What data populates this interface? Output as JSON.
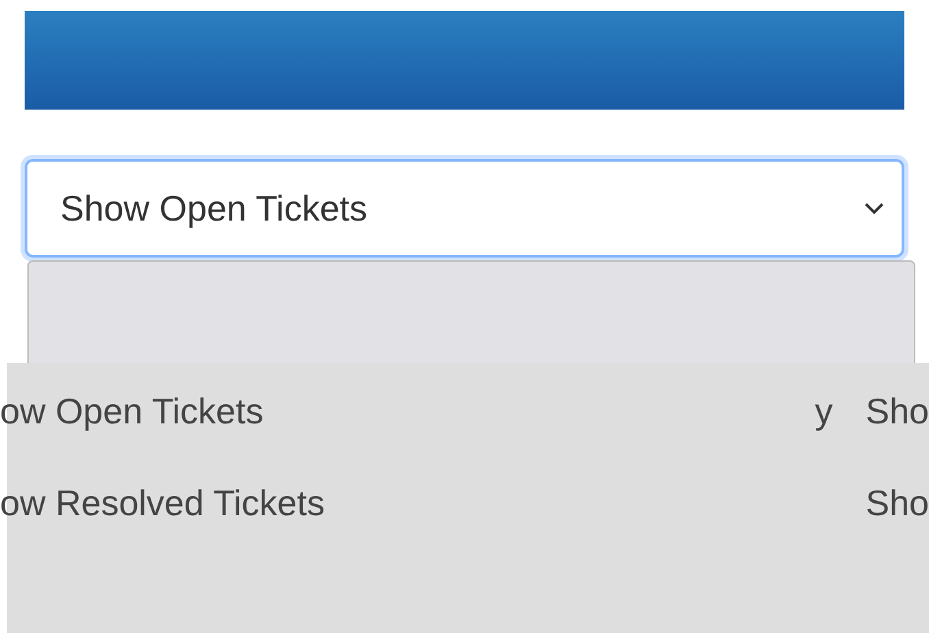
{
  "select": {
    "value": "Show Open Tickets"
  },
  "dropdown": {
    "options": [
      {
        "label": "ow Open Tickets",
        "fragments": [
          "y",
          "Sho"
        ]
      },
      {
        "label": "ow Resolved Tickets",
        "fragments": [
          "Sho"
        ]
      }
    ]
  }
}
